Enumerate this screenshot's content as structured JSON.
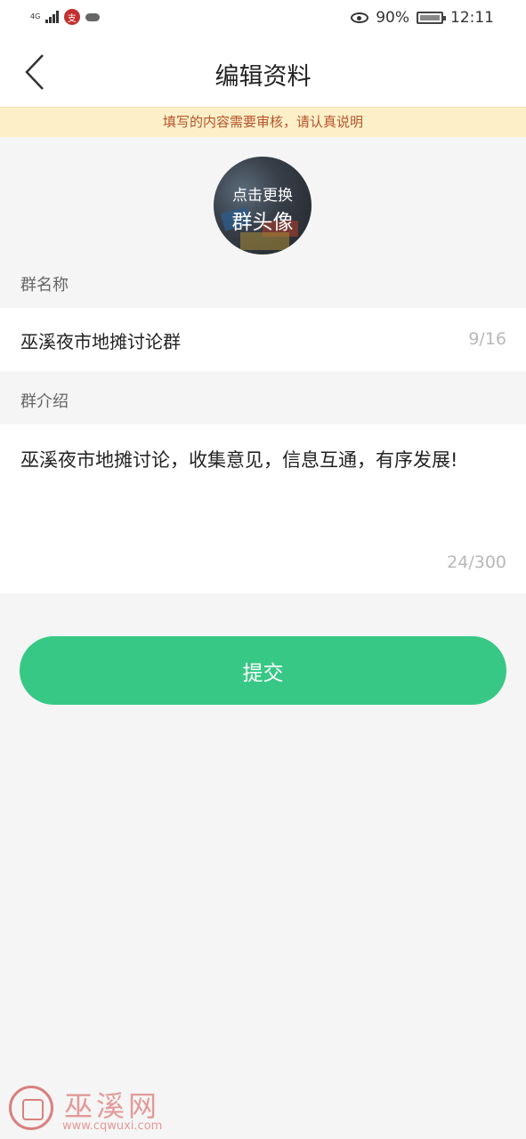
{
  "status_bar": {
    "network": "4G",
    "notification_badge": "支",
    "battery": "90%",
    "time": "12:11"
  },
  "nav": {
    "title": "编辑资料"
  },
  "notice": "填写的内容需要审核，请认真说明",
  "avatar": {
    "line1": "点击更换",
    "line2": "群头像"
  },
  "group_name": {
    "label": "群名称",
    "value": "巫溪夜市地摊讨论群",
    "counter": "9/16"
  },
  "group_intro": {
    "label": "群介绍",
    "value": "巫溪夜市地摊讨论，收集意见，信息互通，有序发展!",
    "counter": "24/300"
  },
  "submit_label": "提交",
  "watermark": {
    "title": "巫溪网",
    "url": "www.cqwuxi.com"
  },
  "colors": {
    "accent": "#37c885",
    "notice_bg": "#fdf0c8",
    "notice_text": "#b5522b"
  }
}
